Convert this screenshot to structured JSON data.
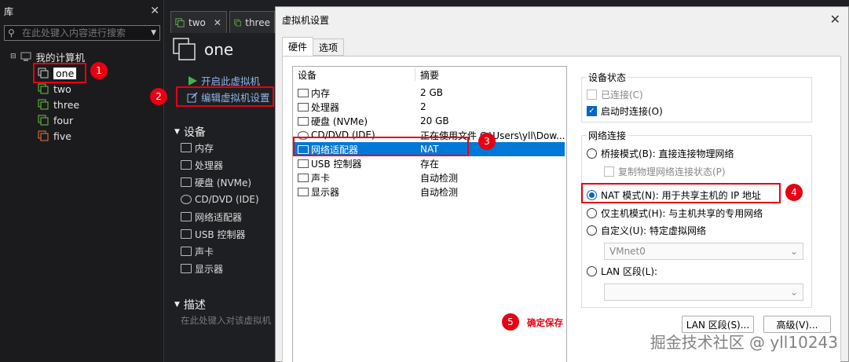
{
  "library": {
    "title": "库",
    "search_placeholder": "在此处键入内容进行搜索",
    "root": "我的计算机",
    "vms": [
      "one",
      "two",
      "three",
      "four",
      "five"
    ]
  },
  "workspace": {
    "tabs": [
      "two",
      "three"
    ],
    "vm_name": "one",
    "actions": {
      "power_on": "开启此虚拟机",
      "edit_settings": "编辑虚拟机设置"
    },
    "devices_header": "设备",
    "devices": [
      "内存",
      "处理器",
      "硬盘 (NVMe)",
      "CD/DVD (IDE)",
      "网络适配器",
      "USB 控制器",
      "声卡",
      "显示器"
    ],
    "description_header": "描述",
    "description_placeholder": "在此处键入对该虚拟机"
  },
  "dialog": {
    "title": "虚拟机设置",
    "tabs": [
      "硬件",
      "选项"
    ],
    "list_headers": {
      "device": "设备",
      "summary": "摘要"
    },
    "rows": [
      {
        "device": "内存",
        "summary": "2 GB"
      },
      {
        "device": "处理器",
        "summary": "2"
      },
      {
        "device": "硬盘 (NVMe)",
        "summary": "20 GB"
      },
      {
        "device": "CD/DVD (IDE)",
        "summary": "正在使用文件 C:\\Users\\yll\\Dow..."
      },
      {
        "device": "网络适配器",
        "summary": "NAT"
      },
      {
        "device": "USB 控制器",
        "summary": "存在"
      },
      {
        "device": "声卡",
        "summary": "自动检测"
      },
      {
        "device": "显示器",
        "summary": "自动检测"
      }
    ],
    "device_status": {
      "title": "设备状态",
      "connected": "已连接(C)",
      "connect_at_power_on": "启动时连接(O)"
    },
    "network": {
      "title": "网络连接",
      "bridged": "桥接模式(B): 直接连接物理网络",
      "replicate": "复制物理网络连接状态(P)",
      "nat": "NAT 模式(N): 用于共享主机的 IP 地址",
      "host_only": "仅主机模式(H): 与主机共享的专用网络",
      "custom": "自定义(U): 特定虚拟网络",
      "custom_value": "VMnet0",
      "lan": "LAN 区段(L):",
      "lan_value": ""
    },
    "buttons": {
      "lan_segments": "LAN 区段(S)...",
      "advanced": "高级(V)..."
    }
  },
  "annotations": {
    "badges": [
      "1",
      "2",
      "3",
      "4",
      "5"
    ],
    "confirm_note": "确定保存"
  },
  "watermark": "掘金技术社区 @ yll10243",
  "colors": {
    "accent": "#0078d7",
    "annotation": "#e60012"
  }
}
